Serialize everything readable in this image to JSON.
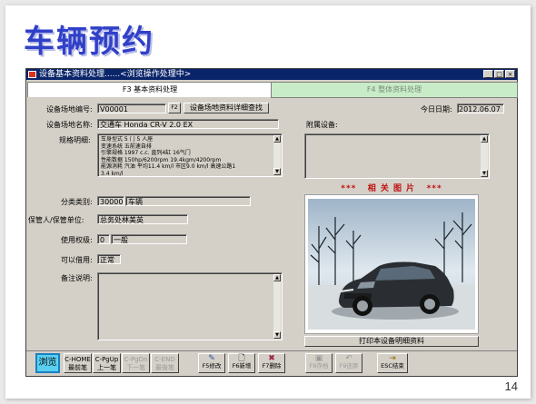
{
  "slide": {
    "title": "车辆预约",
    "page_number": "14"
  },
  "window": {
    "title": "设备基本资料处理......<浏览操作处理中>",
    "controls": [
      "_",
      "□",
      "×"
    ]
  },
  "tabs": [
    {
      "label": "F3 基本资料处理",
      "active": true
    },
    {
      "label": "F4 整体资料处理",
      "active": false
    }
  ],
  "form": {
    "site_code_label": "设备场地编号:",
    "site_code_value": "V00001",
    "f2_button": "F2",
    "detail_query_button": "设备场地资料详细查找",
    "today_label": "今日日期:",
    "today_value": "2012.06.07",
    "site_name_label": "设备场地名称:",
    "site_name_value": "交通车 Honda CR-V 2.0 EX",
    "spec_label": "规格明细:",
    "spec_lines": [
      "车身型式 5 门 5 人座",
      "变速系统 五前速自排",
      "引擎规格 1997 c.c. 直列4缸 16气门",
      "性能数据 150hp/6200rpm 19.4kgm/4200rpm",
      "能源消耗 汽油 平均11.4 km/l 市区9.0 km/l 高速公路1",
      "3.4 km/l"
    ],
    "attached_label": "附属设备:",
    "category_label": "分类类别:",
    "category_code": "30000",
    "category_name": "车辆",
    "custodian_label": "保管人/保管单位:",
    "custodian_value": "总务处林美英",
    "permission_label": "使用权级:",
    "permission_code": "0",
    "permission_name": "一般",
    "borrowable_label": "可以借用:",
    "borrowable_value": "正常",
    "remarks_label": "备注说明:",
    "photo_heading": "***   相 关 图 片   ***",
    "print_button": "打印本设备明细资料"
  },
  "toolbar": {
    "browse": "浏览",
    "nav": [
      {
        "line1": "C-HOME",
        "line2": "最前笔",
        "enabled": true
      },
      {
        "line1": "C-PgUp",
        "line2": "上一笔",
        "enabled": true
      },
      {
        "line1": "C-PgDn",
        "line2": "下一笔",
        "enabled": false
      },
      {
        "line1": "C-END",
        "line2": "最後笔",
        "enabled": false
      }
    ],
    "actions": [
      {
        "icon": "edit-icon",
        "glyph": "✎",
        "label": "F5修改",
        "enabled": true
      },
      {
        "icon": "new-page-icon",
        "glyph": "🗋",
        "label": "F6新增",
        "enabled": true
      },
      {
        "icon": "delete-icon",
        "glyph": "✖",
        "label": "F7删除",
        "enabled": true
      },
      {
        "icon": "save-icon",
        "glyph": "▣",
        "label": "F8存档",
        "enabled": false
      },
      {
        "icon": "restore-icon",
        "glyph": "↶",
        "label": "F9还原",
        "enabled": false
      },
      {
        "icon": "exit-icon",
        "glyph": "⇥",
        "label": "ESC结束",
        "enabled": true
      }
    ]
  },
  "colors": {
    "title_blue": "#3040c8",
    "titlebar": "#0a246a",
    "inactive_tab": "#c8ecc8",
    "photo_heading": "#c01010",
    "browse_button": "#5ad0f0"
  }
}
